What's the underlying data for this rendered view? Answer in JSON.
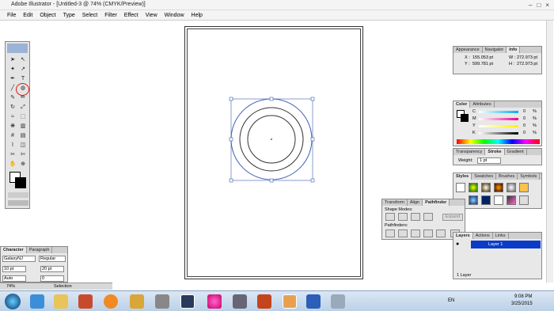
{
  "window": {
    "title": "Adobe Illustrator - [Untitled-3 @ 74% (CMYK/Preview)]"
  },
  "menu": [
    "File",
    "Edit",
    "Object",
    "Type",
    "Select",
    "Filter",
    "Effect",
    "View",
    "Window",
    "Help"
  ],
  "info_panel": {
    "tabs": [
      "Appearance",
      "Navigator",
      "Info"
    ],
    "x_label": "X :",
    "x": "155.053 pt",
    "y_label": "Y :",
    "y": "599.781 pt",
    "w_label": "W :",
    "w": "272.973 pt",
    "h_label": "H :",
    "h": "272.973 pt"
  },
  "color_panel": {
    "tabs": [
      "Color",
      "Attributes"
    ],
    "channels": [
      "C",
      "M",
      "Y",
      "K"
    ],
    "values": [
      "0",
      "0",
      "0",
      "0"
    ],
    "unit": "%"
  },
  "stroke_panel": {
    "tabs": [
      "Transparency",
      "Stroke",
      "Gradient"
    ],
    "weight_label": "Weight:",
    "weight": "1 pt"
  },
  "styles_panel": {
    "tabs": [
      "Styles",
      "Swatches",
      "Brushes",
      "Symbols"
    ]
  },
  "pathfinder_panel": {
    "tabs": [
      "Transform",
      "Align",
      "Pathfinder"
    ],
    "shape_modes": "Shape Modes:",
    "pathfinders": "Pathfinders:",
    "expand": "Expand"
  },
  "layers_panel": {
    "tabs": [
      "Layers",
      "Actions",
      "Links"
    ],
    "layer": "Layer 1",
    "count": "1 Layer"
  },
  "character_panel": {
    "tabs": [
      "Character",
      "Paragraph"
    ],
    "font": "GalaxyNJ",
    "style": "Regular",
    "size": "10 pt",
    "leading": "20 pt",
    "kerning": "Auto",
    "tracking": "0"
  },
  "status": {
    "zoom": "74%",
    "mode": "Selection"
  },
  "taskbar": {
    "lang": "EN",
    "time": "9:08 PM",
    "date": "3/25/2015"
  },
  "colors": {
    "selection": "#3b5fb0",
    "layer_highlight": "#0a3cc8"
  }
}
